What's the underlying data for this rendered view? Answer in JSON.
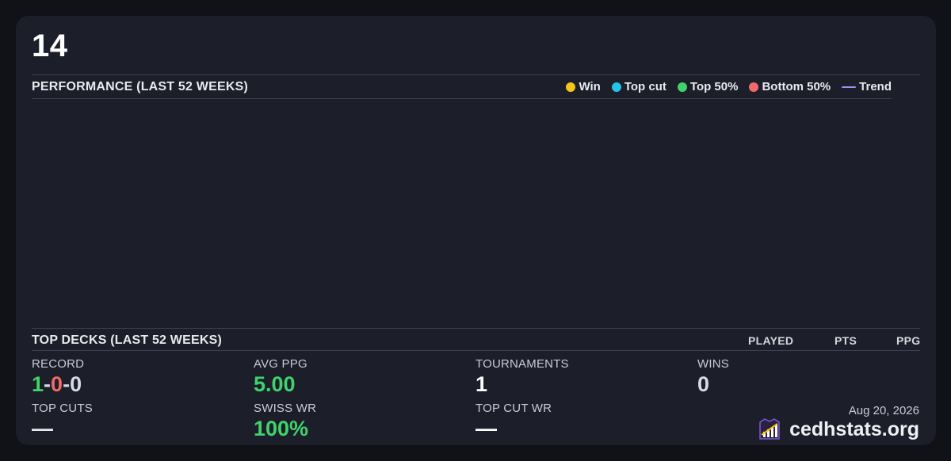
{
  "header": {
    "title": "14"
  },
  "performance": {
    "label": "PERFORMANCE (LAST 52 WEEKS)",
    "legend": [
      {
        "label": "Win",
        "color": "#f5c518",
        "kind": "dot"
      },
      {
        "label": "Top cut",
        "color": "#22c5e8",
        "kind": "dot"
      },
      {
        "label": "Top 50%",
        "color": "#3fd46b",
        "kind": "dot"
      },
      {
        "label": "Bottom 50%",
        "color": "#f06a6a",
        "kind": "dot"
      },
      {
        "label": "Trend",
        "color": "#a98bf5",
        "kind": "line"
      }
    ]
  },
  "top_decks": {
    "label": "TOP DECKS (LAST 52 WEEKS)",
    "columns": {
      "played": "PLAYED",
      "pts": "PTS",
      "ppg": "PPG"
    }
  },
  "stats": {
    "record": {
      "label": "RECORD",
      "wins": "1",
      "sep1": "-",
      "losses": "0",
      "sep2": "-",
      "draws": "0",
      "win_color": "#3fd46b",
      "loss_color": "#f06a6a"
    },
    "avg_ppg": {
      "label": "AVG PPG",
      "value": "5.00",
      "color": "#3fd46b"
    },
    "tournaments": {
      "label": "TOURNAMENTS",
      "value": "1"
    },
    "wins": {
      "label": "WINS",
      "value": "0"
    },
    "top_cuts": {
      "label": "TOP CUTS",
      "value": "—"
    },
    "swiss_wr": {
      "label": "SWISS WR",
      "value": "100%",
      "color": "#3fd46b"
    },
    "top_cut_wr": {
      "label": "TOP CUT WR",
      "value": "—"
    }
  },
  "footer": {
    "date": "Aug 20, 2026",
    "brand": "cedhstats.org",
    "logo_icon": "bar-chart-crest-icon"
  }
}
